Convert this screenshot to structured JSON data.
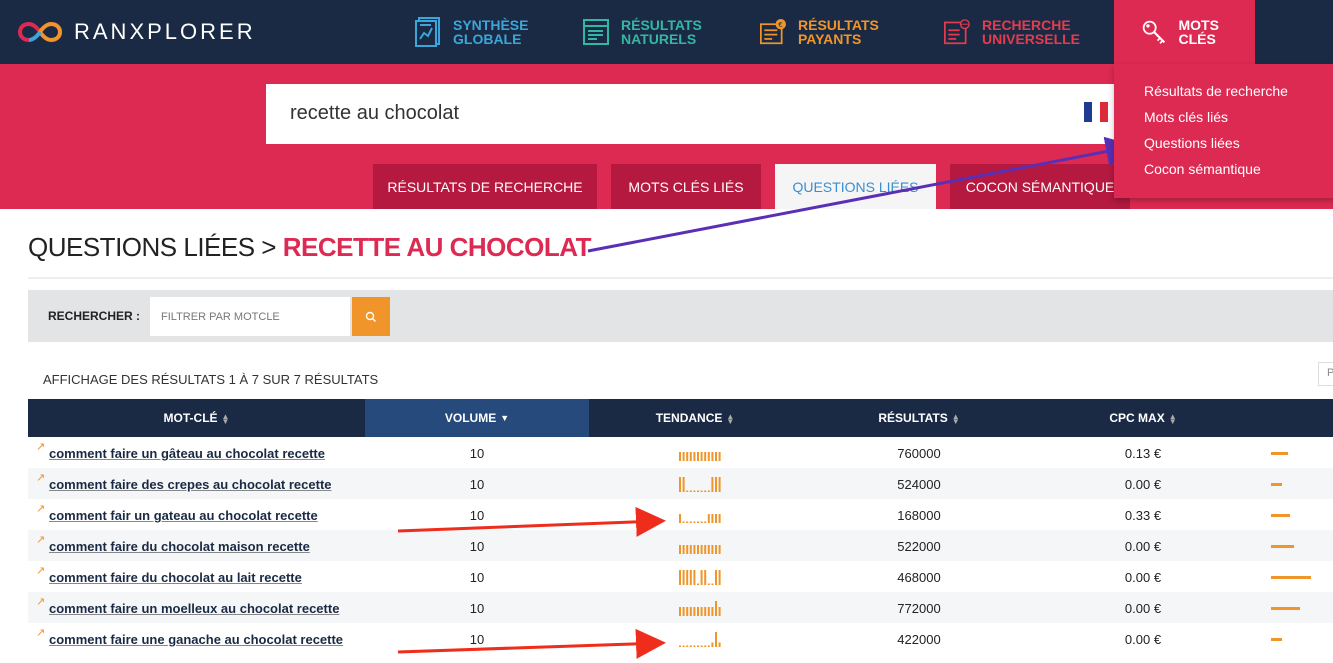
{
  "app": {
    "brand": "RANXPLORER",
    "brand_colors": {
      "nav_bg": "#1b2a44",
      "accent": "#dd2a52",
      "orange": "#f0952a"
    }
  },
  "nav": {
    "items": [
      {
        "id": "synthese",
        "label": "SYNTHÈSE GLOBALE",
        "icon": "document-chart-icon",
        "color": "#3aa6d9"
      },
      {
        "id": "naturels",
        "label": "RÉSULTATS NATURELS",
        "icon": "list-window-icon",
        "color": "#35b6a2"
      },
      {
        "id": "payants",
        "label": "RÉSULTATS PAYANTS",
        "icon": "euro-list-icon",
        "color": "#f0952a"
      },
      {
        "id": "universelle",
        "label": "RECHERCHE UNIVERSELLE",
        "icon": "globe-list-icon",
        "color": "#e63b4b"
      },
      {
        "id": "mots",
        "label": "MOTS CLÉS",
        "icon": "key-icon",
        "color": "#ffffff"
      }
    ],
    "dropdown": [
      "Résultats de recherche",
      "Mots clés liés",
      "Questions liées",
      "Cocon sémantique"
    ]
  },
  "search": {
    "value": "recette au chocolat",
    "flag": "france-flag-icon"
  },
  "tabs": [
    {
      "label": "RÉSULTATS DE RECHERCHE",
      "active": false
    },
    {
      "label": "MOTS CLÉS LIÉS",
      "active": false
    },
    {
      "label": "QUESTIONS LIÉES",
      "active": true
    },
    {
      "label": "COCON SÉMANTIQUE",
      "active": false
    }
  ],
  "heading": {
    "prefix": "QUESTIONS LIÉES >",
    "keyword": "RECETTE AU CHOCOLAT"
  },
  "filter": {
    "label": "RECHERCHER :",
    "placeholder": "FILTRER PAR MOTCLE"
  },
  "results_info": "AFFICHAGE DES RÉSULTATS 1 À 7 SUR 7 RÉSULTATS",
  "pagination_glyph": "P",
  "table": {
    "columns": [
      {
        "label": "MOT-CLÉ",
        "sort": "both"
      },
      {
        "label": "VOLUME",
        "sort": "desc"
      },
      {
        "label": "TENDANCE",
        "sort": "both"
      },
      {
        "label": "RÉSULTATS",
        "sort": "both"
      },
      {
        "label": "CPC MAX",
        "sort": "both"
      }
    ],
    "rows": [
      {
        "keyword": "comment faire un gâteau au chocolat recette",
        "volume": "10",
        "trend": [
          0.6,
          0.6,
          0.6,
          0.6,
          0.6,
          0.6,
          0.6,
          0.6,
          0.6,
          0.6,
          0.6,
          0.6
        ],
        "results": "760000",
        "cpc": "0.13 €",
        "competition": 0.4
      },
      {
        "keyword": "comment faire des crepes au chocolat recette",
        "volume": "10",
        "trend": [
          1,
          1,
          0.1,
          0.1,
          0.1,
          0.1,
          0.1,
          0.1,
          0.1,
          1,
          1,
          1
        ],
        "results": "524000",
        "cpc": "0.00 €",
        "competition": 0.25
      },
      {
        "keyword": "comment fair un gateau au chocolat recette",
        "volume": "10",
        "trend": [
          0.6,
          0.1,
          0.1,
          0.1,
          0.1,
          0.1,
          0.1,
          0.1,
          0.6,
          0.6,
          0.6,
          0.6
        ],
        "results": "168000",
        "cpc": "0.33 €",
        "competition": 0.45
      },
      {
        "keyword": "comment faire du chocolat maison recette",
        "volume": "10",
        "trend": [
          0.6,
          0.6,
          0.6,
          0.6,
          0.6,
          0.6,
          0.6,
          0.6,
          0.6,
          0.6,
          0.6,
          0.6
        ],
        "results": "522000",
        "cpc": "0.00 €",
        "competition": 0.55
      },
      {
        "keyword": "comment faire du chocolat au lait recette",
        "volume": "10",
        "trend": [
          1,
          1,
          1,
          1,
          1,
          0.1,
          1,
          1,
          0.1,
          0.1,
          1,
          1
        ],
        "results": "468000",
        "cpc": "0.00 €",
        "competition": 0.95
      },
      {
        "keyword": "comment faire un moelleux au chocolat recette",
        "volume": "10",
        "trend": [
          0.6,
          0.6,
          0.6,
          0.6,
          0.6,
          0.6,
          0.6,
          0.6,
          0.6,
          0.6,
          1,
          0.6
        ],
        "results": "772000",
        "cpc": "0.00 €",
        "competition": 0.7
      },
      {
        "keyword": "comment faire une ganache au chocolat recette",
        "volume": "10",
        "trend": [
          0.1,
          0.1,
          0.1,
          0.1,
          0.1,
          0.1,
          0.1,
          0.1,
          0.1,
          0.3,
          1,
          0.3
        ],
        "results": "422000",
        "cpc": "0.00 €",
        "competition": 0.25
      }
    ]
  }
}
